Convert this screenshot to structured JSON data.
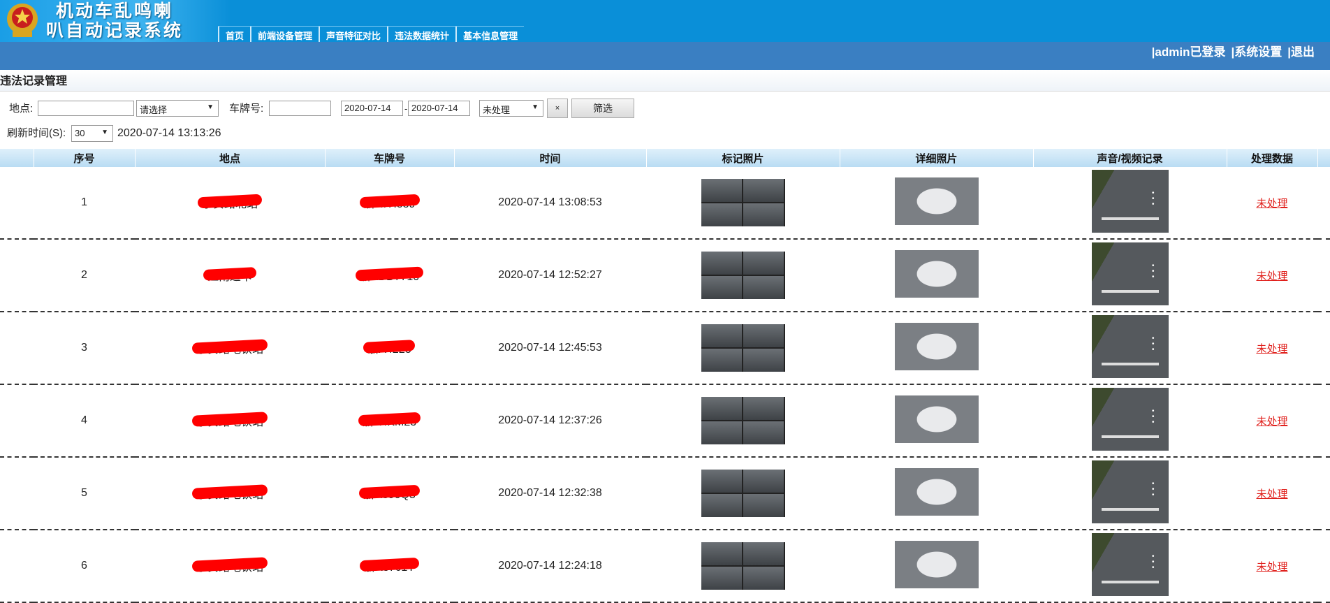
{
  "app": {
    "title_line1": "机动车乱鸣喇",
    "title_line2": "叭自动记录系统"
  },
  "nav": [
    "首页",
    "前端设备管理",
    "声音特征对比",
    "违法数据统计",
    "基本信息管理"
  ],
  "user_links": [
    "|admin已登录",
    "|系统设置",
    "|退出"
  ],
  "section_title": "违法记录管理",
  "filter": {
    "location_label": "地点:",
    "location_value": "",
    "select_placeholder": "请选择",
    "plate_label": "车牌号:",
    "plate_value": "",
    "date_from": "2020-07-14",
    "date_sep": "-",
    "date_to": "2020-07-14",
    "status_value": "未处理",
    "clear_label": "×",
    "filter_button": "筛选",
    "refresh_label": "刷新时间(S):",
    "refresh_value": "30",
    "current_time": "2020-07-14 13:13:26"
  },
  "table": {
    "headers": [
      "序号",
      "地点",
      "车牌号",
      "时间",
      "标记照片",
      "详细照片",
      "声音/视频记录",
      "处理数据"
    ],
    "rows": [
      {
        "no": "1",
        "location": "宁安路北站",
        "plate": "浙A7H839",
        "time": "2020-07-14 13:08:53",
        "action": "未处理"
      },
      {
        "no": "2",
        "location": "江南道卡",
        "plate": "浙ADD7710",
        "time": "2020-07-14 12:52:27",
        "action": "未处理"
      },
      {
        "no": "3",
        "location": "宁安路地铁站",
        "plate": "浙A4228",
        "time": "2020-07-14 12:45:53",
        "action": "未处理"
      },
      {
        "no": "4",
        "location": "宁安路地铁站",
        "plate": "浙A4KM23",
        "time": "2020-07-14 12:37:26",
        "action": "未处理"
      },
      {
        "no": "5",
        "location": "宁安路地铁站",
        "plate": "浙A390Q5",
        "time": "2020-07-14 12:32:38",
        "action": "未处理"
      },
      {
        "no": "6",
        "location": "宁安路地铁站",
        "plate": "浙A3761Y",
        "time": "2020-07-14 12:24:18",
        "action": "未处理"
      }
    ]
  }
}
